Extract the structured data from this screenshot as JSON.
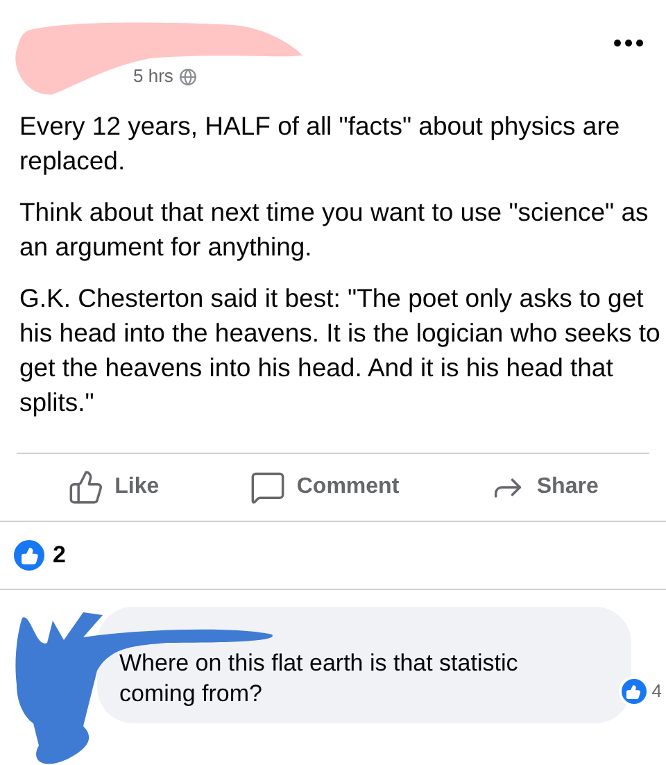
{
  "post": {
    "time": "5 hrs",
    "paragraphs": [
      "Every 12 years, HALF of all \"facts\" about physics are replaced.",
      "Think about that next time you want to use \"science\" as an argument for anything.",
      "G.K. Chesterton said it best: \"The poet only asks to get his head into the heavens. It is the logician who seeks to get the heavens into his head. And it is his head that splits.\""
    ]
  },
  "actions": [
    {
      "kind": "like",
      "label": "Like"
    },
    {
      "kind": "comment",
      "label": "Comment"
    },
    {
      "kind": "share",
      "label": "Share"
    }
  ],
  "reactions": {
    "count": "2"
  },
  "comment": {
    "text": "Where on this flat earth is that statistic coming from?",
    "likes": "4"
  }
}
